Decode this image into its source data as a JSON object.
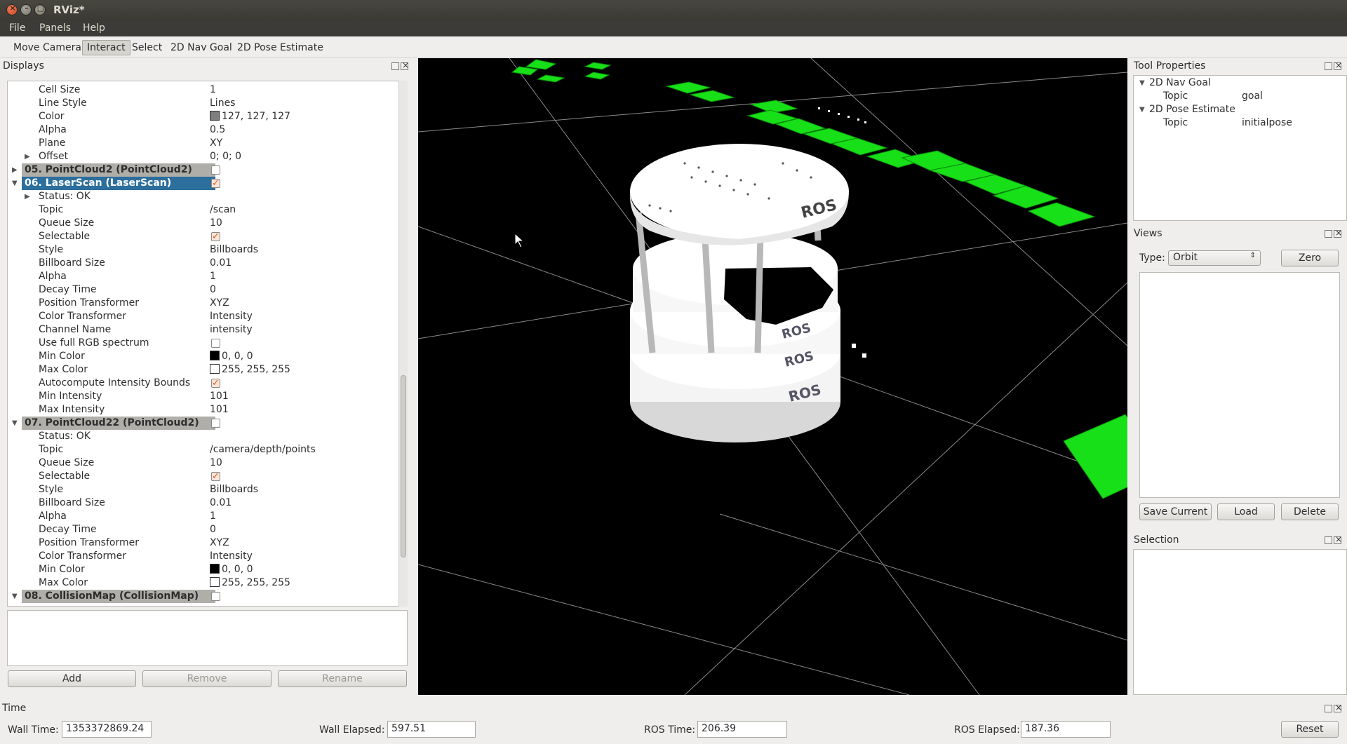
{
  "window": {
    "title": "RViz*"
  },
  "menu": [
    {
      "label": "File"
    },
    {
      "label": "Panels"
    },
    {
      "label": "Help"
    }
  ],
  "toolbar": {
    "tools": [
      "Move Camera",
      "Interact",
      "Select",
      "2D Nav Goal",
      "2D Pose Estimate"
    ],
    "active": "Interact"
  },
  "displays": {
    "title": "Displays",
    "rows": [
      {
        "k": "Cell Size",
        "v": "1",
        "indent": 2
      },
      {
        "k": "Line Style",
        "v": "Lines",
        "indent": 2
      },
      {
        "k": "Color",
        "v": "127, 127, 127",
        "indent": 2,
        "swatch": "#7f7f7f"
      },
      {
        "k": "Alpha",
        "v": "0.5",
        "indent": 2
      },
      {
        "k": "Plane",
        "v": "XY",
        "indent": 2
      },
      {
        "k": "Offset",
        "v": "0; 0; 0",
        "indent": 2,
        "arrow": "▶"
      },
      {
        "k": "05. PointCloud2 (PointCloud2)",
        "indent": 1,
        "arrow": "▶",
        "group": true,
        "check": false
      },
      {
        "k": "06. LaserScan (LaserScan)",
        "indent": 1,
        "arrow": "▼",
        "group": true,
        "selected": true,
        "check": true
      },
      {
        "k": "Status: OK",
        "indent": 2,
        "arrow": "▶"
      },
      {
        "k": "Topic",
        "v": "/scan",
        "indent": 2
      },
      {
        "k": "Queue Size",
        "v": "10",
        "indent": 2
      },
      {
        "k": "Selectable",
        "indent": 2,
        "check": true
      },
      {
        "k": "Style",
        "v": "Billboards",
        "indent": 2
      },
      {
        "k": "Billboard Size",
        "v": "0.01",
        "indent": 2
      },
      {
        "k": "Alpha",
        "v": "1",
        "indent": 2
      },
      {
        "k": "Decay Time",
        "v": "0",
        "indent": 2
      },
      {
        "k": "Position Transformer",
        "v": "XYZ",
        "indent": 2
      },
      {
        "k": "Color Transformer",
        "v": "Intensity",
        "indent": 2
      },
      {
        "k": "Channel Name",
        "v": "intensity",
        "indent": 2
      },
      {
        "k": "Use full RGB spectrum",
        "indent": 2,
        "check": false
      },
      {
        "k": "Min Color",
        "v": "0, 0, 0",
        "indent": 2,
        "swatch": "#000000"
      },
      {
        "k": "Max Color",
        "v": "255, 255, 255",
        "indent": 2,
        "swatch": "#ffffff"
      },
      {
        "k": "Autocompute Intensity Bounds",
        "indent": 2,
        "check": true
      },
      {
        "k": "Min Intensity",
        "v": "101",
        "indent": 2
      },
      {
        "k": "Max Intensity",
        "v": "101",
        "indent": 2
      },
      {
        "k": "07. PointCloud22 (PointCloud2)",
        "indent": 1,
        "arrow": "▼",
        "group": true,
        "check": false
      },
      {
        "k": "Status: OK",
        "indent": 2
      },
      {
        "k": "Topic",
        "v": "/camera/depth/points",
        "indent": 2
      },
      {
        "k": "Queue Size",
        "v": "10",
        "indent": 2
      },
      {
        "k": "Selectable",
        "indent": 2,
        "check": true
      },
      {
        "k": "Style",
        "v": "Billboards",
        "indent": 2
      },
      {
        "k": "Billboard Size",
        "v": "0.01",
        "indent": 2
      },
      {
        "k": "Alpha",
        "v": "1",
        "indent": 2
      },
      {
        "k": "Decay Time",
        "v": "0",
        "indent": 2
      },
      {
        "k": "Position Transformer",
        "v": "XYZ",
        "indent": 2
      },
      {
        "k": "Color Transformer",
        "v": "Intensity",
        "indent": 2
      },
      {
        "k": "Min Color",
        "v": "0, 0, 0",
        "indent": 2,
        "swatch": "#000000"
      },
      {
        "k": "Max Color",
        "v": "255, 255, 255",
        "indent": 2,
        "swatch": "#ffffff"
      },
      {
        "k": "08. CollisionMap (CollisionMap)",
        "indent": 1,
        "arrow": "▼",
        "group": true,
        "check": false
      }
    ],
    "buttons": {
      "add": "Add",
      "remove": "Remove",
      "rename": "Rename"
    }
  },
  "toolProperties": {
    "title": "Tool Properties",
    "items": [
      {
        "k": "2D Nav Goal",
        "group": true
      },
      {
        "k": "Topic",
        "v": "goal"
      },
      {
        "k": "2D Pose Estimate",
        "group": true
      },
      {
        "k": "Topic",
        "v": "initialpose"
      }
    ]
  },
  "views": {
    "title": "Views",
    "type_label": "Type:",
    "type_value": "Orbit",
    "zero": "Zero",
    "save": "Save Current",
    "load": "Load",
    "delete": "Delete"
  },
  "selection": {
    "title": "Selection"
  },
  "time": {
    "title": "Time",
    "wall_time_label": "Wall Time:",
    "wall_time": "1353372869.24",
    "wall_elapsed_label": "Wall Elapsed:",
    "wall_elapsed": "597.51",
    "ros_time_label": "ROS Time:",
    "ros_time": "206.39",
    "ros_elapsed_label": "ROS Elapsed:",
    "ros_elapsed": "187.36",
    "reset": "Reset"
  },
  "robot_label": "ROS",
  "colors": {
    "grid_cell": "#10e010",
    "background": "#000000",
    "selected_row": "#2c6e9c"
  }
}
